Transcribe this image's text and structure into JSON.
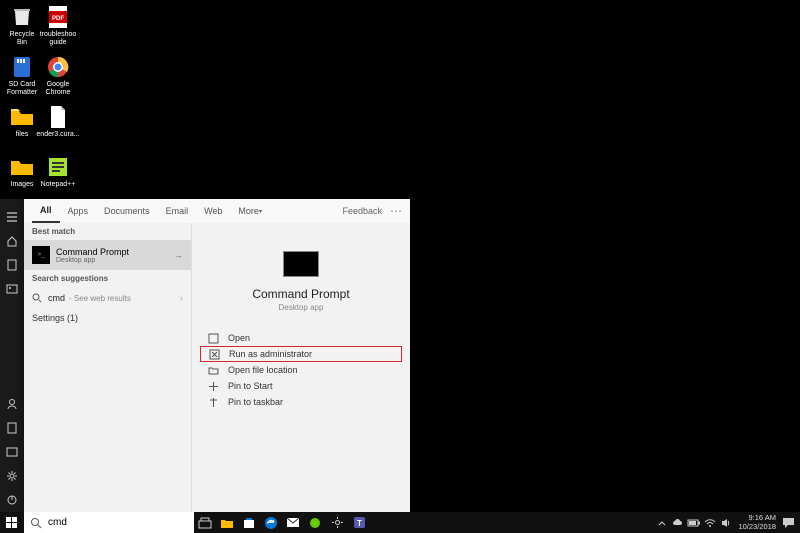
{
  "desktop_icons": [
    {
      "label": "Recycle Bin"
    },
    {
      "label": "troubleshoo guide"
    },
    {
      "label": "SD Card Formatter"
    },
    {
      "label": "Google Chrome"
    },
    {
      "label": "files"
    },
    {
      "label": "ender3.cura..."
    },
    {
      "label": "Images"
    },
    {
      "label": "Notepad++"
    }
  ],
  "tabs": {
    "all": "All",
    "apps": "Apps",
    "documents": "Documents",
    "email": "Email",
    "web": "Web",
    "more": "More",
    "feedback": "Feedback"
  },
  "left": {
    "best_match_hdr": "Best match",
    "best_name": "Command Prompt",
    "best_sub": "Desktop app",
    "suggestions_hdr": "Search suggestions",
    "sugg_query": "cmd",
    "sugg_extra": "- See web results",
    "settings": "Settings (1)"
  },
  "right": {
    "title": "Command Prompt",
    "subtitle": "Desktop app",
    "actions": {
      "open": "Open",
      "runadmin": "Run as administrator",
      "openloc": "Open file location",
      "pinstart": "Pin to Start",
      "pintask": "Pin to taskbar"
    }
  },
  "search": {
    "value": "cmd"
  },
  "clock": {
    "time": "9:16 AM",
    "date": "10/23/2018"
  }
}
